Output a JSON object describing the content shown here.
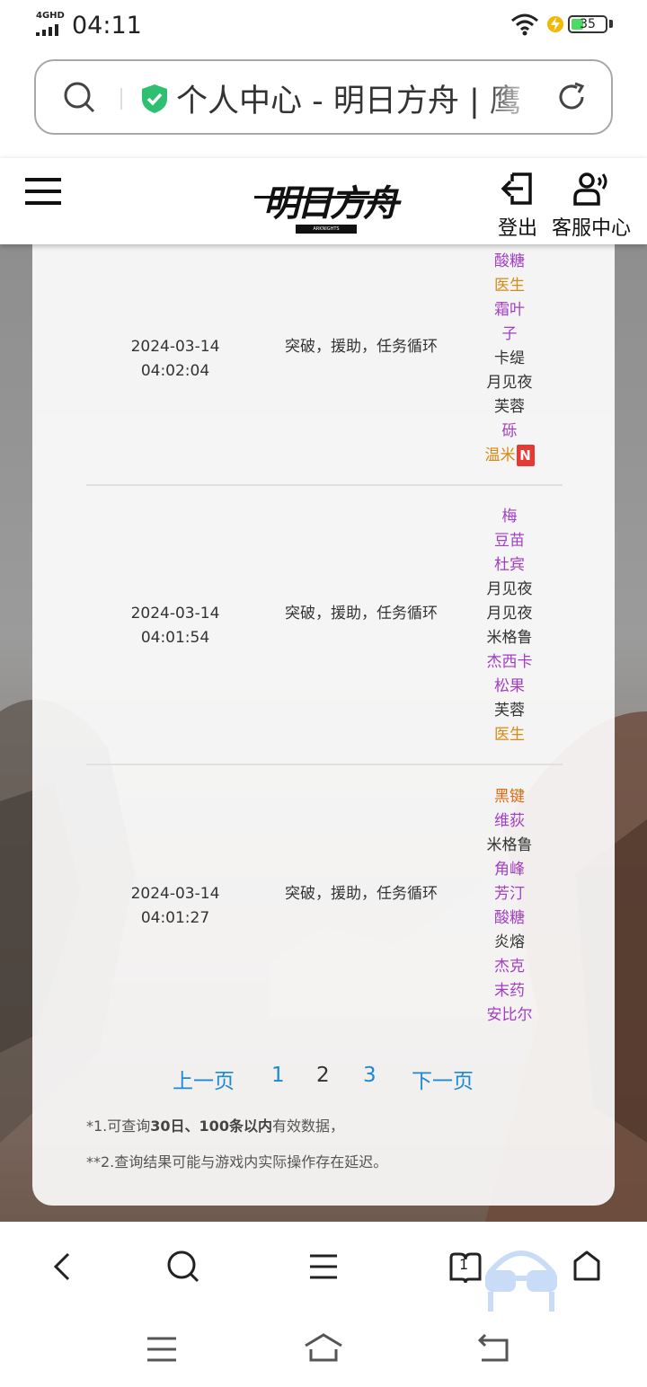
{
  "status": {
    "network": "4GHD",
    "time": "04:11",
    "battery": "35"
  },
  "urlbar": {
    "title": "个人中心 - 明日方舟 | 鹰"
  },
  "header": {
    "logo": "明日方舟",
    "logout_label": "登出",
    "service_label": "客服中心"
  },
  "records": [
    {
      "date": "2024-03-14",
      "time": "04:02:04",
      "source": "突破，援助，任务循环",
      "chars": [
        {
          "name": "酸糖",
          "color": "#a33ec4"
        },
        {
          "name": "医生",
          "color": "#d68a14"
        },
        {
          "name": "霜叶",
          "color": "#a33ec4"
        },
        {
          "name": "子",
          "color": "#a33ec4"
        },
        {
          "name": "卡缇",
          "color": "#333333"
        },
        {
          "name": "月见夜",
          "color": "#333333"
        },
        {
          "name": "芙蓉",
          "color": "#333333"
        },
        {
          "name": "砾",
          "color": "#a33ec4"
        },
        {
          "name": "温米",
          "color": "#d68a14",
          "badge": "N"
        }
      ]
    },
    {
      "date": "2024-03-14",
      "time": "04:01:54",
      "source": "突破，援助，任务循环",
      "chars": [
        {
          "name": "梅",
          "color": "#a33ec4"
        },
        {
          "name": "豆苗",
          "color": "#a33ec4"
        },
        {
          "name": "杜宾",
          "color": "#a33ec4"
        },
        {
          "name": "月见夜",
          "color": "#333333"
        },
        {
          "name": "月见夜",
          "color": "#333333"
        },
        {
          "name": "米格鲁",
          "color": "#333333"
        },
        {
          "name": "杰西卡",
          "color": "#a33ec4"
        },
        {
          "name": "松果",
          "color": "#a33ec4"
        },
        {
          "name": "芙蓉",
          "color": "#333333"
        },
        {
          "name": "医生",
          "color": "#d68a14"
        }
      ]
    },
    {
      "date": "2024-03-14",
      "time": "04:01:27",
      "source": "突破，援助，任务循环",
      "chars": [
        {
          "name": "黑键",
          "color": "#e06a12"
        },
        {
          "name": "维荻",
          "color": "#a33ec4"
        },
        {
          "name": "米格鲁",
          "color": "#333333"
        },
        {
          "name": "角峰",
          "color": "#a33ec4"
        },
        {
          "name": "芳汀",
          "color": "#a33ec4"
        },
        {
          "name": "酸糖",
          "color": "#a33ec4"
        },
        {
          "name": "炎熔",
          "color": "#333333"
        },
        {
          "name": "杰克",
          "color": "#a33ec4"
        },
        {
          "name": "末药",
          "color": "#a33ec4"
        },
        {
          "name": "安比尔",
          "color": "#a33ec4"
        }
      ]
    }
  ],
  "pagination": {
    "prev": "上一页",
    "pages": [
      "1",
      "2",
      "3"
    ],
    "current": "2",
    "next": "下一页"
  },
  "notes": {
    "n1_prefix": "*1.可查询",
    "n1_bold": "30日、100条以内",
    "n1_suffix": "有效数据，",
    "n2": "**2.查询结果可能与游戏内实际操作存在延迟。"
  },
  "nav": {
    "tabs_count": "1"
  }
}
